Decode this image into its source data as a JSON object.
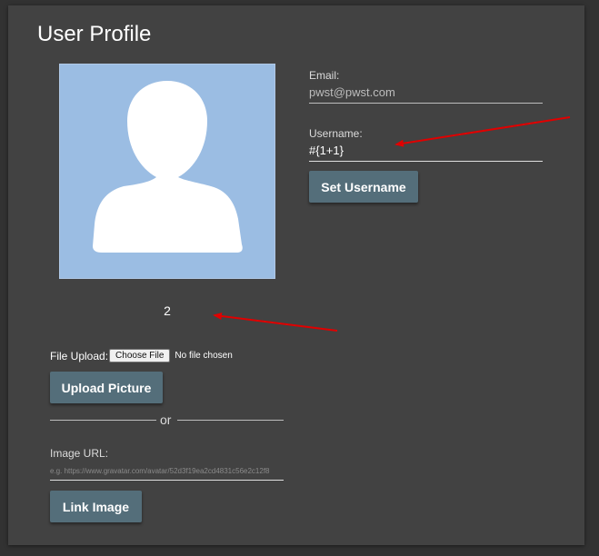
{
  "page": {
    "title": "User Profile"
  },
  "avatar": {
    "icon": "user-silhouette-icon",
    "bg_color": "#9bbde3"
  },
  "counter": "2",
  "email": {
    "label": "Email:",
    "value": "pwst@pwst.com"
  },
  "username": {
    "label": "Username:",
    "value": "#{1+1}"
  },
  "buttons": {
    "set_username": "Set Username",
    "upload_picture": "Upload Picture",
    "link_image": "Link Image"
  },
  "file_upload": {
    "label": "File Upload:",
    "choose_label": "Choose File",
    "status": "No file chosen"
  },
  "divider": {
    "text": "or"
  },
  "image_url": {
    "label": "Image URL:",
    "placeholder": "e.g. https://www.gravatar.com/avatar/52d3f19ea2cd4831c56e2c12f8"
  },
  "annotations": {
    "arrow_color": "#e00000",
    "arrows": [
      "arrow-to-username-value",
      "arrow-to-counter"
    ]
  },
  "colors": {
    "page_bg": "#323232",
    "card_bg": "#424242",
    "button_bg": "#546e7a"
  }
}
